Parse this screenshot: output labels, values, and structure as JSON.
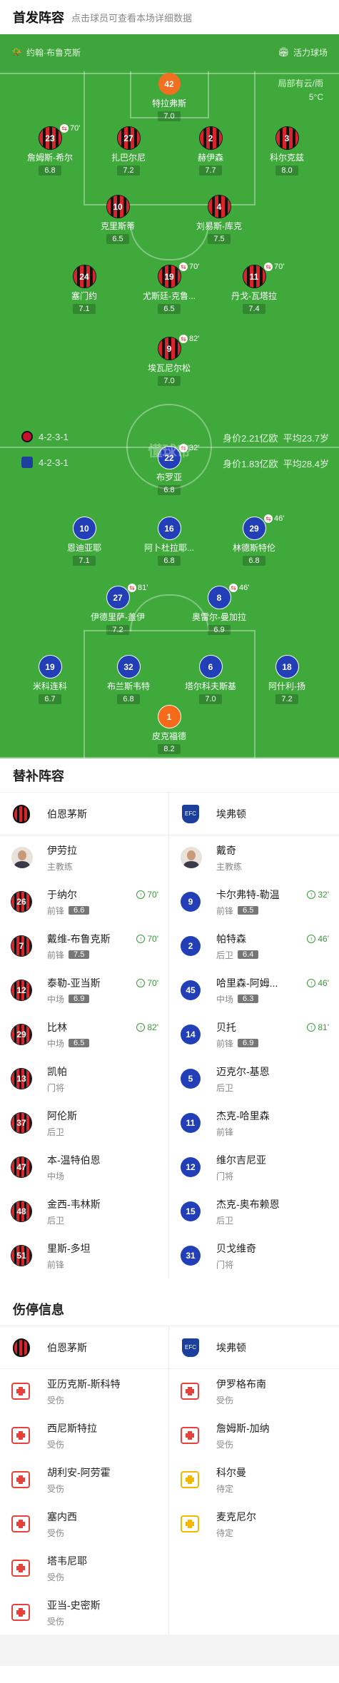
{
  "header": {
    "title": "首发阵容",
    "subtitle": "点击球员可查看本场详细数据"
  },
  "venue": {
    "referee": "约翰·布鲁克斯",
    "stadium": "活力球场",
    "weather": "局部有云/雨",
    "temp": "5°C"
  },
  "bournemouth": {
    "formation": "4-2-3-1",
    "value": "身价2.21亿欧",
    "age": "平均23.7岁",
    "players": [
      {
        "num": "42",
        "name": "特拉弗斯",
        "rating": "7.0",
        "gk": true
      },
      {
        "num": "23",
        "name": "詹姆斯-希尔",
        "rating": "6.8",
        "sub": "70'"
      },
      {
        "num": "27",
        "name": "扎巴尔尼",
        "rating": "7.2"
      },
      {
        "num": "2",
        "name": "赫伊森",
        "rating": "7.7"
      },
      {
        "num": "3",
        "name": "科尔克兹",
        "rating": "8.0"
      },
      {
        "num": "10",
        "name": "克里斯蒂",
        "rating": "6.5"
      },
      {
        "num": "4",
        "name": "刘易斯-库克",
        "rating": "7.5"
      },
      {
        "num": "24",
        "name": "塞门约",
        "rating": "7.1"
      },
      {
        "num": "19",
        "name": "尤斯廷-克鲁...",
        "rating": "6.5",
        "sub": "70'"
      },
      {
        "num": "11",
        "name": "丹戈-瓦塔拉",
        "rating": "7.4",
        "sub": "70'"
      },
      {
        "num": "9",
        "name": "埃瓦尼尔松",
        "rating": "7.0",
        "sub": "82'"
      }
    ]
  },
  "everton": {
    "formation": "4-2-3-1",
    "value": "身价1.83亿欧",
    "age": "平均28.4岁",
    "players": [
      {
        "num": "22",
        "name": "布罗亚",
        "rating": "6.8",
        "sub": "32'"
      },
      {
        "num": "10",
        "name": "恩迪亚耶",
        "rating": "7.1"
      },
      {
        "num": "16",
        "name": "阿卜杜拉耶...",
        "rating": "6.8"
      },
      {
        "num": "29",
        "name": "林德斯特伦",
        "rating": "6.8",
        "sub": "46'"
      },
      {
        "num": "27",
        "name": "伊德里萨-盖伊",
        "rating": "7.2",
        "sub": "81'"
      },
      {
        "num": "8",
        "name": "奥雷尔-曼加拉",
        "rating": "6.9",
        "sub": "46'"
      },
      {
        "num": "19",
        "name": "米科连科",
        "rating": "6.7"
      },
      {
        "num": "32",
        "name": "布兰斯韦特",
        "rating": "6.8"
      },
      {
        "num": "6",
        "name": "塔尔科夫斯基",
        "rating": "7.0"
      },
      {
        "num": "18",
        "name": "阿什利-扬",
        "rating": "7.2"
      },
      {
        "num": "1",
        "name": "皮克福德",
        "rating": "8.2",
        "gk": true
      }
    ]
  },
  "watermark": "懂球帝",
  "subs": {
    "title": "替补阵容",
    "home": "伯恩茅斯",
    "away": "埃弗顿",
    "coach_home": {
      "name": "伊劳拉",
      "role": "主教练"
    },
    "coach_away": {
      "name": "戴奇",
      "role": "主教练"
    },
    "home_list": [
      {
        "num": "26",
        "name": "于纳尔",
        "pos": "前锋",
        "rating": "6.6",
        "in": "70'"
      },
      {
        "num": "7",
        "name": "戴维-布鲁克斯",
        "pos": "前锋",
        "rating": "7.5",
        "in": "70'"
      },
      {
        "num": "12",
        "name": "泰勒-亚当斯",
        "pos": "中场",
        "rating": "6.9",
        "in": "70'"
      },
      {
        "num": "29",
        "name": "比林",
        "pos": "中场",
        "rating": "6.5",
        "in": "82'"
      },
      {
        "num": "13",
        "name": "凯帕",
        "pos": "门将"
      },
      {
        "num": "37",
        "name": "阿伦斯",
        "pos": "后卫"
      },
      {
        "num": "47",
        "name": "本-温特伯恩",
        "pos": "中场"
      },
      {
        "num": "48",
        "name": "金西-韦林斯",
        "pos": "后卫"
      },
      {
        "num": "51",
        "name": "里斯-多坦",
        "pos": "前锋"
      }
    ],
    "away_list": [
      {
        "num": "9",
        "name": "卡尔弗特-勒温",
        "pos": "前锋",
        "rating": "6.5",
        "in": "32'"
      },
      {
        "num": "2",
        "name": "帕特森",
        "pos": "后卫",
        "rating": "6.4",
        "in": "46'"
      },
      {
        "num": "45",
        "name": "哈里森-阿姆...",
        "pos": "中场",
        "rating": "6.3",
        "in": "46'"
      },
      {
        "num": "14",
        "name": "贝托",
        "pos": "前锋",
        "rating": "6.9",
        "in": "81'"
      },
      {
        "num": "5",
        "name": "迈克尔-基恩",
        "pos": "后卫"
      },
      {
        "num": "11",
        "name": "杰克-哈里森",
        "pos": "前锋"
      },
      {
        "num": "12",
        "name": "维尔吉尼亚",
        "pos": "门将"
      },
      {
        "num": "15",
        "name": "杰克-奥布赖恩",
        "pos": "后卫"
      },
      {
        "num": "31",
        "name": "贝戈维奇",
        "pos": "门将"
      }
    ]
  },
  "injuries": {
    "title": "伤停信息",
    "home": "伯恩茅斯",
    "away": "埃弗顿",
    "home_list": [
      {
        "name": "亚历克斯-斯科特",
        "status": "受伤"
      },
      {
        "name": "西尼斯特拉",
        "status": "受伤"
      },
      {
        "name": "胡利安-阿劳霍",
        "status": "受伤"
      },
      {
        "name": "塞内西",
        "status": "受伤"
      },
      {
        "name": "塔韦尼耶",
        "status": "受伤"
      },
      {
        "name": "亚当-史密斯",
        "status": "受伤"
      }
    ],
    "away_list": [
      {
        "name": "伊罗格布南",
        "status": "受伤"
      },
      {
        "name": "詹姆斯-加纳",
        "status": "受伤"
      },
      {
        "name": "科尔曼",
        "status": "待定"
      },
      {
        "name": "麦克尼尔",
        "status": "待定"
      }
    ]
  }
}
